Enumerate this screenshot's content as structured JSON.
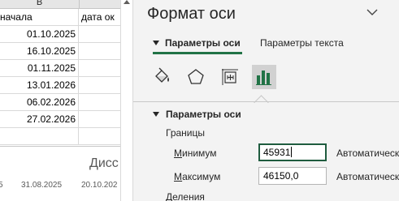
{
  "sheet": {
    "column_header": "B",
    "rows": [
      {
        "b": "начала",
        "c": "дата ок"
      },
      {
        "b": "01.10.2025",
        "c": ""
      },
      {
        "b": "16.10.2025",
        "c": ""
      },
      {
        "b": "01.11.2025",
        "c": ""
      },
      {
        "b": "13.01.2026",
        "c": ""
      },
      {
        "b": "06.02.2026",
        "c": ""
      },
      {
        "b": "27.02.2026",
        "c": ""
      },
      {
        "b": "",
        "c": ""
      }
    ]
  },
  "chart": {
    "title_fragment": "Дисс",
    "axis_ticks": [
      "5",
      "31.08.2025",
      "20.10.202"
    ]
  },
  "pane": {
    "title": "Формат оси",
    "tabs": {
      "axis_options": "Параметры оси",
      "text_options": "Параметры текста"
    },
    "icons": [
      "fill-line-icon",
      "effects-icon",
      "size-properties-icon",
      "axis-options-icon"
    ],
    "section_title": "Параметры оси",
    "bounds_label": "Границы",
    "minimum": {
      "label_accel": "М",
      "label_rest": "инимум",
      "value": "45931",
      "auto": "Автоматическ"
    },
    "maximum": {
      "label_accel": "М",
      "label_rest": "аксимум",
      "value": "46150,0",
      "auto": "Автоматическ"
    },
    "ticks_label": "Деления"
  },
  "colors": {
    "accent_green": "#217346",
    "chart_icon_green": "#217346",
    "pane_background": "#f3f3f3"
  }
}
